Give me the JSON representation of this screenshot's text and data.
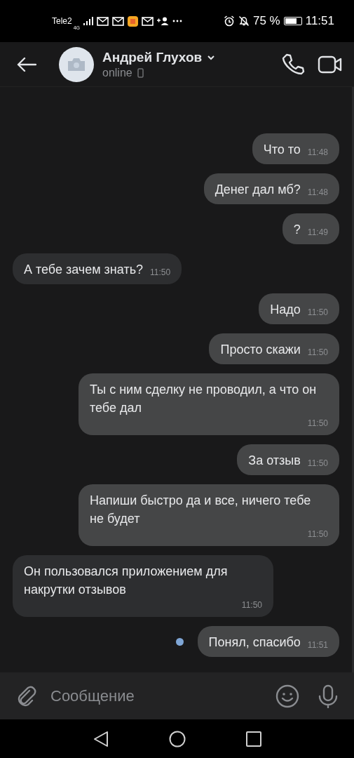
{
  "status_bar": {
    "carrier": "Tele2",
    "network": "4G",
    "battery": "75 %",
    "time": "11:51"
  },
  "header": {
    "name": "Андрей Глухов",
    "status": "online"
  },
  "messages": [
    {
      "kind": "outgoing",
      "text": "Что то",
      "time": "11:48",
      "unread": false
    },
    {
      "kind": "outgoing",
      "text": "Денег дал мб?",
      "time": "11:48",
      "unread": false
    },
    {
      "kind": "outgoing",
      "text": "?",
      "time": "11:49",
      "unread": false
    },
    {
      "kind": "incoming",
      "text": "А тебе зачем знать?",
      "time": "11:50",
      "unread": false
    },
    {
      "kind": "outgoing",
      "text": "Надо",
      "time": "11:50",
      "unread": false
    },
    {
      "kind": "outgoing",
      "text": "Просто скажи",
      "time": "11:50",
      "unread": false
    },
    {
      "kind": "outgoing",
      "text": "Ты с ним сделку не проводил, а что он тебе дал",
      "time": "11:50",
      "unread": false
    },
    {
      "kind": "outgoing",
      "text": "За отзыв",
      "time": "11:50",
      "unread": false
    },
    {
      "kind": "outgoing",
      "text": "Напиши быстро да и все, ничего тебе не будет",
      "time": "11:50",
      "unread": false
    },
    {
      "kind": "incoming",
      "text": "Он пользовался приложением для накрутки отзывов",
      "time": "11:50",
      "unread": false
    },
    {
      "kind": "outgoing",
      "text": "Понял, спасибо",
      "time": "11:51",
      "unread": true
    }
  ],
  "composer": {
    "placeholder": "Сообщение"
  }
}
